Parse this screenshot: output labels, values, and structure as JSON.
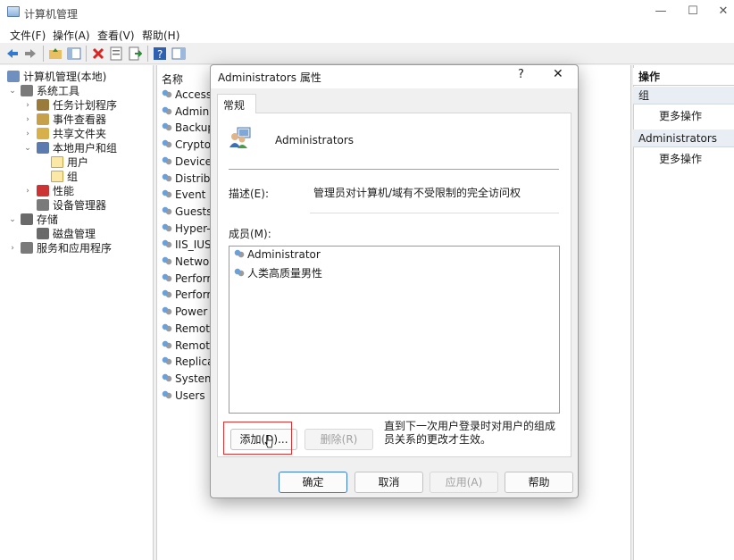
{
  "window": {
    "title": "计算机管理",
    "minimize": "—",
    "maximize": "☐",
    "close": "✕"
  },
  "menu": [
    "文件(F)",
    "操作(A)",
    "查看(V)",
    "帮助(H)"
  ],
  "tree": [
    {
      "label": "计算机管理(本地)",
      "indent": 0,
      "arrow": ""
    },
    {
      "label": "系统工具",
      "indent": 1,
      "arrow": "⌄"
    },
    {
      "label": "任务计划程序",
      "indent": 2,
      "arrow": "›"
    },
    {
      "label": "事件查看器",
      "indent": 2,
      "arrow": "›"
    },
    {
      "label": "共享文件夹",
      "indent": 2,
      "arrow": "›"
    },
    {
      "label": "本地用户和组",
      "indent": 2,
      "arrow": "⌄"
    },
    {
      "label": "用户",
      "indent": 3,
      "arrow": ""
    },
    {
      "label": "组",
      "indent": 3,
      "arrow": ""
    },
    {
      "label": "性能",
      "indent": 2,
      "arrow": "›"
    },
    {
      "label": "设备管理器",
      "indent": 2,
      "arrow": ""
    },
    {
      "label": "存储",
      "indent": 1,
      "arrow": "⌄"
    },
    {
      "label": "磁盘管理",
      "indent": 2,
      "arrow": ""
    },
    {
      "label": "服务和应用程序",
      "indent": 1,
      "arrow": "›"
    }
  ],
  "list": {
    "header": "名称",
    "rows": [
      "Access C",
      "Adminis",
      "Backup O",
      "Cryptog",
      "Device O",
      "Distribut",
      "Event Lo",
      "Guests",
      "Hyper-V",
      "IIS_IUSR",
      "Network",
      "Perform",
      "Perform",
      "Power U",
      "Remote",
      "Remote",
      "Replicat",
      "System I",
      "Users"
    ]
  },
  "actions": {
    "header": "操作",
    "section1": "组",
    "more1": "更多操作",
    "section2": "Administrators",
    "more2": "更多操作"
  },
  "dialog": {
    "title": "Administrators 属性",
    "help": "?",
    "close": "✕",
    "tab": "常规",
    "group_name": "Administrators",
    "desc_label": "描述(E):",
    "desc_value": "管理员对计算机/域有不受限制的完全访问权",
    "members_label": "成员(M):",
    "members": [
      "Administrator",
      "人类高质量男性"
    ],
    "add": "添加(D)...",
    "remove": "删除(R)",
    "note": "直到下一次用户登录时对用户的组成员关系的更改才生效。",
    "ok": "确定",
    "cancel": "取消",
    "apply": "应用(A)",
    "helpbtn": "帮助"
  },
  "colors": {
    "accent": "#3a7bd5",
    "selection": "#cce8ff",
    "highlight_box": "#dd3333"
  }
}
